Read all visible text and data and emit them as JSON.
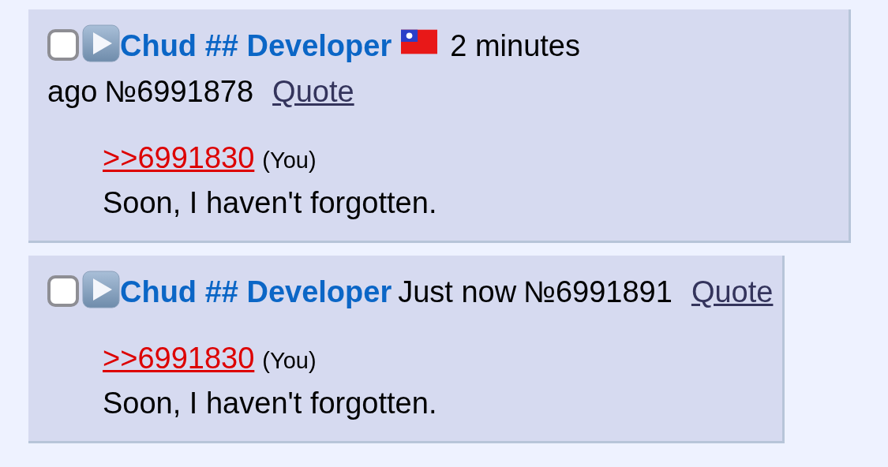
{
  "posts": [
    {
      "checked": false,
      "name": "Chud ## Developer",
      "flag": true,
      "time_lines": [
        "2 minutes",
        "ago"
      ],
      "number": "№6991878",
      "quote_action": "Quote",
      "reply_to": ">>6991830",
      "you_marker": "(You)",
      "message": "Soon, I haven't forgotten."
    },
    {
      "checked": false,
      "name": "Chud ## Developer",
      "flag": false,
      "time_lines": [
        "Just now"
      ],
      "number": "№6991891",
      "quote_action": "Quote",
      "reply_to": ">>6991830",
      "you_marker": "(You)",
      "message": "Soon, I haven't forgotten."
    }
  ]
}
